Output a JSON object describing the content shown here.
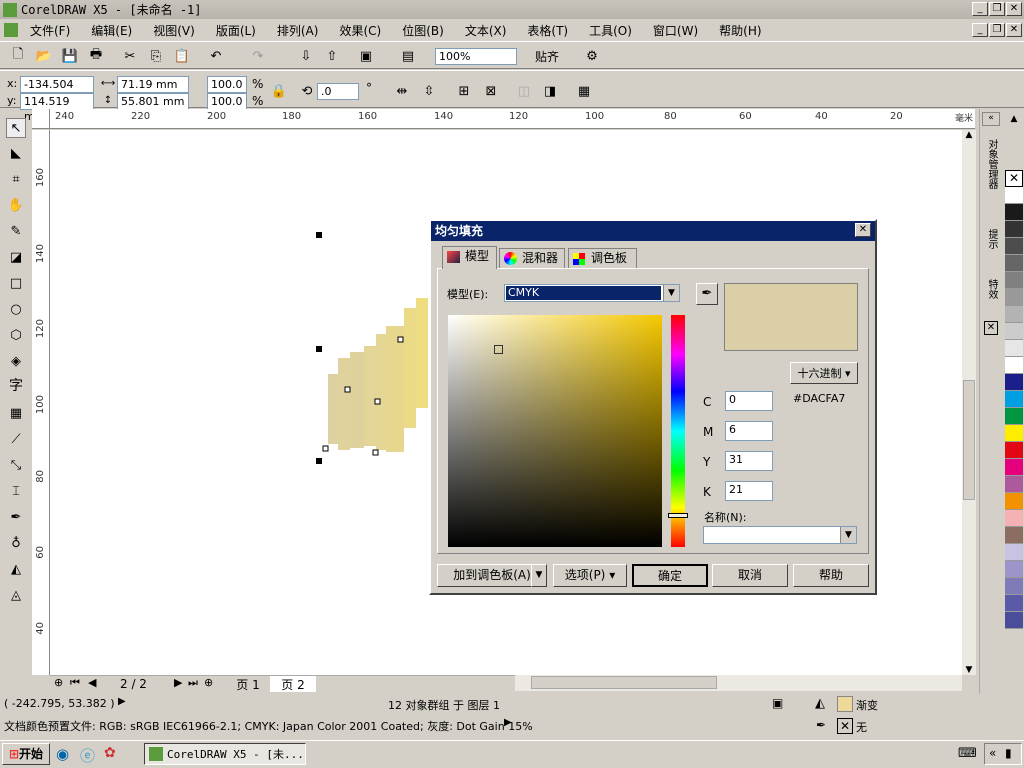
{
  "app": {
    "title": "CorelDRAW X5 - [未命名 -1]"
  },
  "menu": [
    "文件(F)",
    "编辑(E)",
    "视图(V)",
    "版面(L)",
    "排列(A)",
    "效果(C)",
    "位图(B)",
    "文本(X)",
    "表格(T)",
    "工具(O)",
    "窗口(W)",
    "帮助(H)"
  ],
  "toolbar": {
    "zoom": "100%",
    "snap_label": "贴齐"
  },
  "propbar": {
    "x": "-134.504 mm",
    "y": "114.519 mm",
    "w": "71.19 mm",
    "h": "55.801 mm",
    "sx": "100.0",
    "sy": "100.0",
    "pct": "%",
    "angle": ".0",
    "deg": "°"
  },
  "ruler_h": [
    "240",
    "220",
    "200",
    "180",
    "160",
    "140",
    "120",
    "100",
    "80",
    "60",
    "40",
    "20",
    "毫米"
  ],
  "ruler_v": [
    "160",
    "140",
    "120",
    "100",
    "80",
    "60",
    "40"
  ],
  "dialog": {
    "title": "均匀填充",
    "tabs": [
      "模型",
      "混和器",
      "调色板"
    ],
    "model_label": "模型(E):",
    "model_value": "CMYK",
    "hex_mode": "十六进制",
    "hex_value": "#DACFA7",
    "swatch_color": "#DACFA7",
    "c_label": "C",
    "c": "0",
    "m_label": "M",
    "m": "6",
    "y_label": "Y",
    "y": "31",
    "k_label": "K",
    "k": "21",
    "name_label": "名称(N):",
    "add_palette": "加到调色板(A)",
    "options": "选项(P)",
    "ok": "确定",
    "cancel": "取消",
    "help": "帮助"
  },
  "pages": {
    "counter": "2 / 2",
    "page1": "页 1",
    "page2": "页 2"
  },
  "status": {
    "coords": "( -242.795, 53.382 )",
    "selection": "12 对象群组 于 图层 1",
    "fill_label": "渐变",
    "outline_label": "无",
    "profile": "文档颜色预置文件: RGB: sRGB IEC61966-2.1; CMYK: Japan Color 2001 Coated; 灰度: Dot Gain 15%"
  },
  "dockers": [
    "对象管理器",
    "提示",
    "特效"
  ],
  "taskbar": {
    "start": "开始",
    "task": "CorelDRAW X5 - [未..."
  },
  "palette": [
    "#ffffff",
    "#1a1a1a",
    "#333333",
    "#4d4d4d",
    "#666666",
    "#808080",
    "#999999",
    "#b3b3b3",
    "#cccccc",
    "#e6e6e6",
    "#ffffff",
    "#1b1f8a",
    "#009fe3",
    "#009640",
    "#ffed00",
    "#e30613",
    "#e6007e",
    "#ad5a9d",
    "#f39200",
    "#f5b1b3",
    "#8c6d62",
    "#c9c3e3",
    "#9d95c9",
    "#7f7ab8",
    "#5b5aa6",
    "#4a4d9a"
  ]
}
